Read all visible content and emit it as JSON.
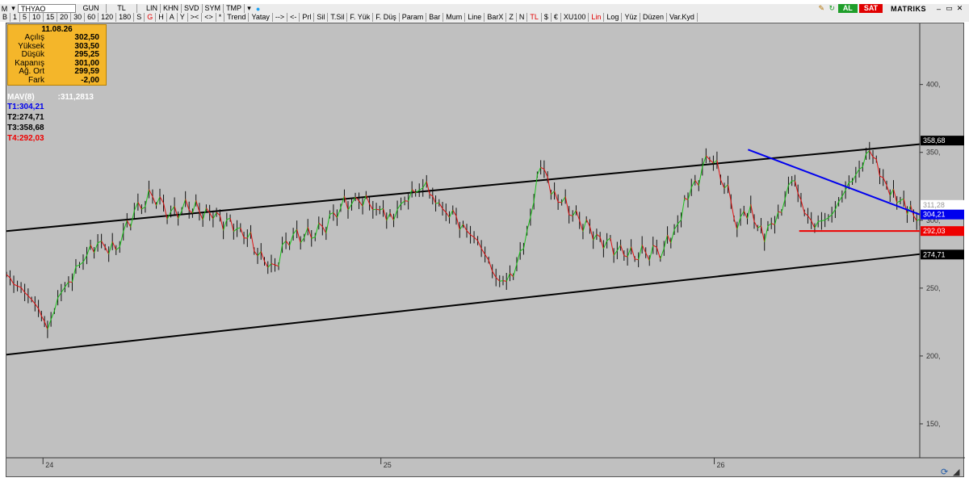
{
  "toolbar1": {
    "symbol": "THYAO",
    "period": "GUN",
    "currency": "TL",
    "buttons": [
      "LIN",
      "KHN",
      "SVD",
      "SYM",
      "TMP"
    ],
    "al_label": "AL",
    "sat_label": "SAT",
    "brand": "MATRIKS"
  },
  "toolbar2": {
    "items": [
      "B",
      "1",
      "5",
      "10",
      "15",
      "20",
      "30",
      "60",
      "120",
      "180",
      "S",
      "G",
      "H",
      "A",
      "Y",
      "><",
      "<>",
      "*",
      "Trend",
      "Yatay",
      "-->",
      "<-",
      "Prl",
      "Sil",
      "T.Sil",
      "F. Yük",
      "F. Düş",
      "Param",
      "Bar",
      "Mum",
      "Line",
      "BarX",
      "Z",
      "N",
      "TL",
      "$",
      "€",
      "XU100",
      "Lin",
      "Log",
      "Yüz",
      "Düzen",
      "Var.Kyd"
    ],
    "red_items": [
      "G",
      "TL",
      "Lin"
    ]
  },
  "info_panel": {
    "date": "11.08.26",
    "rows": [
      {
        "label": "Açılış",
        "value": "302,50"
      },
      {
        "label": "Yüksek",
        "value": "303,50"
      },
      {
        "label": "Düşük",
        "value": "295,25"
      },
      {
        "label": "Kapanış",
        "value": "301,00"
      },
      {
        "label": "Ağ. Ort",
        "value": "299,59"
      },
      {
        "label": "Fark",
        "value": "-2,00"
      }
    ]
  },
  "indicator": {
    "mav_label": "MAV(8)",
    "mav_value": ":311,2813",
    "trendlines": [
      {
        "label": "T1:304,21",
        "color": "#0000ee"
      },
      {
        "label": "T2:274,71",
        "color": "#000000"
      },
      {
        "label": "T3:358,68",
        "color": "#000000"
      },
      {
        "label": "T4:292,03",
        "color": "#ee0000"
      }
    ]
  },
  "chart_data": {
    "type": "line",
    "symbol": "THYAO",
    "ylim": [
      125,
      445
    ],
    "y_ticks": [
      150,
      200,
      250,
      300,
      350,
      400
    ],
    "x_ticks": [
      "24",
      "25",
      "26"
    ],
    "markers": [
      {
        "text": "358,68",
        "value": 358.68,
        "bg": "#000000",
        "fg": "#ffffff"
      },
      {
        "text": "311,28",
        "value": 311.28,
        "bg": "#ffffff",
        "fg": "#999999"
      },
      {
        "text": "304,21",
        "value": 304.21,
        "bg": "#0000ee",
        "fg": "#ffffff"
      },
      {
        "text": "292,03",
        "value": 292.03,
        "bg": "#ee0000",
        "fg": "#ffffff"
      },
      {
        "text": "274,71",
        "value": 274.71,
        "bg": "#000000",
        "fg": "#ffffff"
      }
    ],
    "price_series": {
      "name": "",
      "t": [
        0,
        0.02,
        0.035,
        0.045,
        0.06,
        0.08,
        0.1,
        0.12,
        0.14,
        0.16,
        0.18,
        0.2,
        0.23,
        0.26,
        0.29,
        0.31,
        0.33,
        0.35,
        0.37,
        0.39,
        0.42,
        0.44,
        0.46,
        0.47,
        0.5,
        0.52,
        0.54,
        0.555,
        0.57,
        0.585,
        0.6,
        0.62,
        0.65,
        0.68,
        0.7,
        0.72,
        0.735,
        0.75,
        0.77,
        0.79,
        0.8,
        0.815,
        0.83,
        0.845,
        0.86,
        0.87,
        0.885,
        0.9,
        0.915,
        0.93,
        0.945,
        0.96,
        0.975,
        0.99,
        1.0
      ],
      "values": [
        257,
        250,
        232,
        222,
        245,
        268,
        283,
        278,
        307,
        318,
        305,
        310,
        302,
        292,
        262,
        288,
        288,
        297,
        312,
        315,
        302,
        316,
        328,
        312,
        298,
        278,
        256,
        258,
        292,
        340,
        320,
        305,
        286,
        274,
        276,
        278,
        300,
        320,
        350,
        320,
        300,
        305,
        290,
        301,
        333,
        312,
        296,
        301,
        318,
        333,
        352,
        330,
        315,
        308,
        301
      ]
    },
    "channel_upper": [
      [
        0,
        292
      ],
      [
        1,
        356
      ]
    ],
    "channel_lower": [
      [
        0,
        201
      ],
      [
        1,
        275
      ]
    ],
    "t1_line": [
      [
        0.812,
        352
      ],
      [
        1,
        304.21
      ]
    ],
    "t4_line": [
      [
        0.868,
        292.03
      ],
      [
        1,
        292.03
      ]
    ]
  }
}
